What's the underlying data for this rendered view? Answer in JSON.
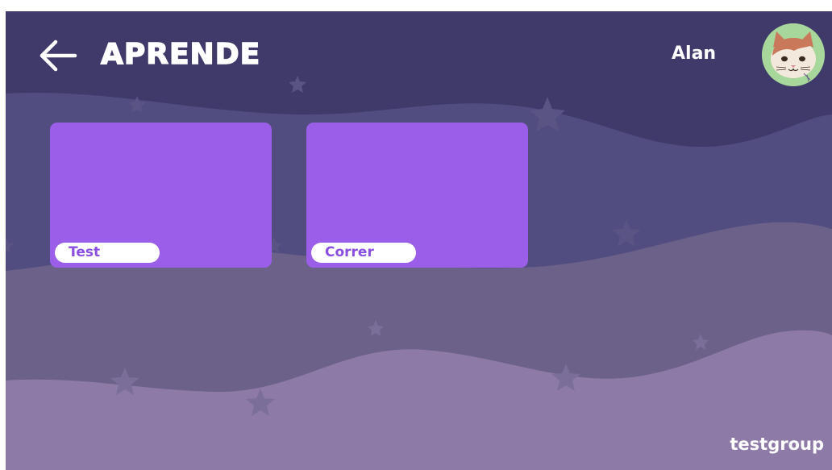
{
  "header": {
    "title": "APRENDE",
    "back_icon": "arrow-left-icon",
    "user_name": "Alan",
    "avatar_icon": "cat-avatar-icon"
  },
  "cards": [
    {
      "label": "Test"
    },
    {
      "label": "Correr"
    }
  ],
  "footer": {
    "group_name": "testgroup"
  },
  "colors": {
    "sky": "#3f3a6a",
    "wave_1": "#524d80",
    "wave_2": "#6c6189",
    "wave_3": "#8e7aa6",
    "card": "#9b5ee8",
    "label_text": "#8b4fe0",
    "avatar_bg": "#a7d79a"
  }
}
